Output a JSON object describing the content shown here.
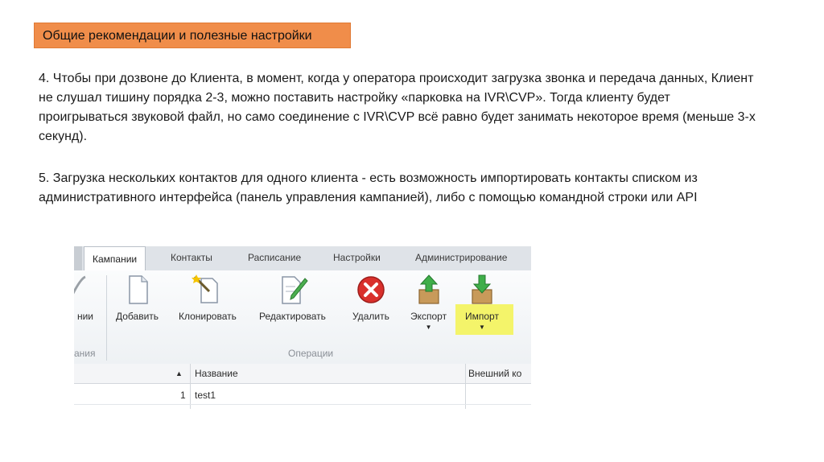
{
  "header": {
    "title": "Общие рекомендации и полезные настройки"
  },
  "paragraphs": [
    "4. Чтобы при дозвоне до Клиента, в момент, когда у оператора происходит загрузка звонка и передача данных, Клиент не слушал тишину порядка 2-3, можно поставить настройку «парковка на IVR\\CVP». Тогда клиенту будет проигрываться звуковой файл, но само соединение с IVR\\CVP всё равно будет занимать некоторое время (меньше 3-х секунд).",
    "5. Загрузка нескольких контактов для одного клиента - есть возможность импортировать контакты списком из административного интерфейса (панель управления кампанией), либо с помощью командной строки или API"
  ],
  "screenshot": {
    "tabs": [
      "Кампании",
      "Контакты",
      "Расписание",
      "Настройки",
      "Администрирование"
    ],
    "active_tab": "Кампании",
    "left_partial_label": "нии",
    "left_partial_group": "ания",
    "buttons": [
      {
        "label": "Добавить",
        "icon": "blank-document-icon"
      },
      {
        "label": "Клонировать",
        "icon": "magic-wand-document-icon"
      },
      {
        "label": "Редактировать",
        "icon": "pencil-document-icon"
      },
      {
        "label": "Удалить",
        "icon": "red-x-delete-icon"
      },
      {
        "label": "Экспорт",
        "icon": "box-arrow-up-icon",
        "dropdown": "▼"
      },
      {
        "label": "Импорт",
        "icon": "box-arrow-down-icon",
        "dropdown": "▼"
      }
    ],
    "group_label": "Операции",
    "highlight_color": "#f4f46a",
    "grid": {
      "sort_indicator": "▲",
      "columns": [
        "Название",
        "Внешний ко"
      ],
      "rows": [
        {
          "num": "1",
          "name": "test1"
        }
      ]
    }
  }
}
